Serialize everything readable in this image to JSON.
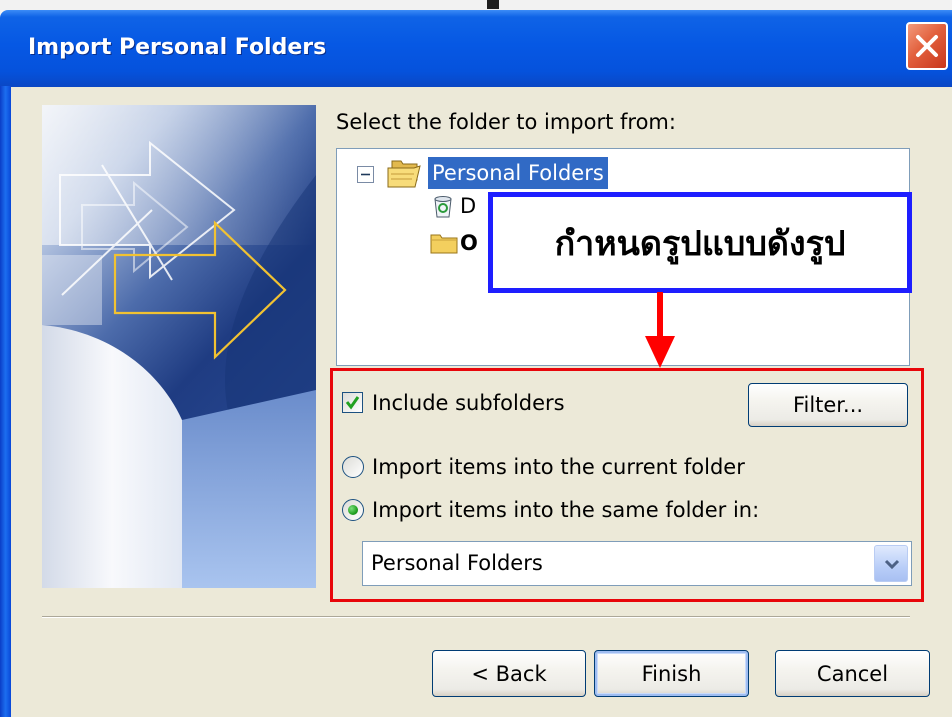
{
  "window": {
    "title": "Import Personal Folders"
  },
  "prompt": "Select the folder to import from:",
  "folder_tree": {
    "items": [
      {
        "label": "Personal Folders",
        "icon": "personal-folders-icon",
        "expander": "collapse-minus-icon",
        "selected": true
      },
      {
        "label": "D",
        "icon": "deleted-items-icon",
        "selected": false
      },
      {
        "label": "O",
        "icon": "folder-icon",
        "selected": false
      }
    ]
  },
  "annotation": {
    "text": "กำหนดรูปแบบดังรูป",
    "box_color": "#1e1eff",
    "arrow_color": "#ff0000",
    "highlight_color": "#e8060a"
  },
  "options": {
    "include_subfolders": {
      "label": "Include subfolders",
      "checked": true
    },
    "filter_button": "Filter...",
    "import_current": {
      "label": "Import items into the current folder",
      "selected": false
    },
    "import_same": {
      "label": "Import items into the same folder in:",
      "selected": true
    },
    "target_folder": {
      "value": "Personal Folders",
      "icon": "chevron-down-icon"
    }
  },
  "buttons": {
    "back": "< Back",
    "finish": "Finish",
    "cancel": "Cancel"
  },
  "colors": {
    "title_bar": "#0558e3",
    "dialog_background": "#ece9d8",
    "selection": "#316ac5",
    "close_button": "#e2603d"
  }
}
